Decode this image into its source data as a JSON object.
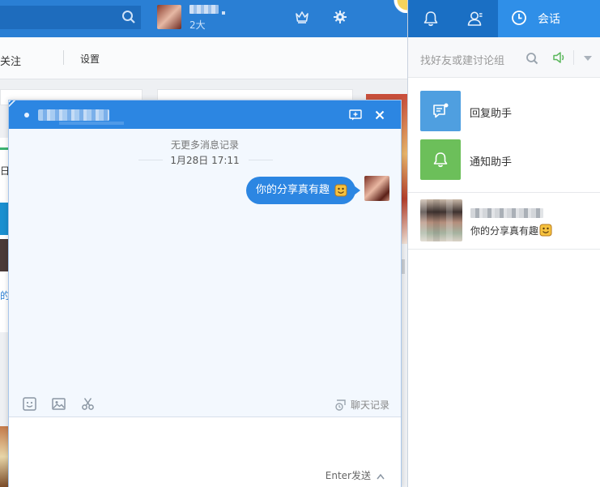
{
  "background": {
    "user_level": "2大",
    "subbar": {
      "follow_label": "关注",
      "settings_label": "设置"
    },
    "strip": {
      "text1": "日",
      "text2": "的"
    }
  },
  "chat": {
    "no_more_records": "无更多消息记录",
    "timestamp": "1月28日 17:11",
    "message": "你的分享真有趣",
    "history_label": "聊天记录",
    "send_hint": "Enter发送",
    "icons": [
      "smiley-icon",
      "image-icon",
      "scissors-icon",
      "add-chat-icon",
      "close-icon"
    ]
  },
  "right_panel": {
    "tabs": [
      {
        "name": "notifications",
        "icon": "bell-icon"
      },
      {
        "name": "contacts",
        "icon": "person-icon"
      },
      {
        "name": "sessions",
        "icon": "clock-icon",
        "label": "会话"
      }
    ],
    "search_placeholder": "找好友或建讨论组",
    "helpers": [
      {
        "label": "回复助手",
        "color": "#4f9fe0"
      },
      {
        "label": "通知助手",
        "color": "#6cbf5a"
      }
    ],
    "conversation": {
      "last_message": "你的分享真有趣"
    }
  },
  "colors": {
    "header_blue": "#2a7fd4",
    "chat_blue": "#2c86e2",
    "panel_tabs": "#1a6fc4",
    "active_tab": "#2f8fe8"
  }
}
